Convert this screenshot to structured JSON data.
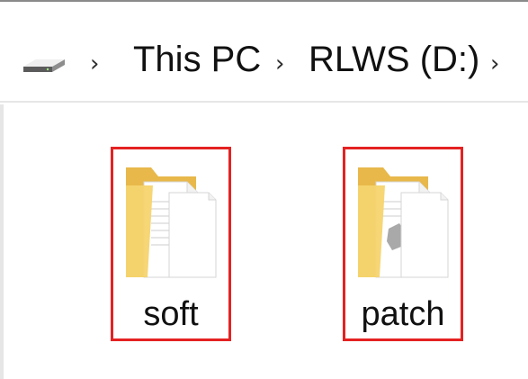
{
  "address_bar": {
    "drive_icon": "drive-icon",
    "crumbs": [
      "This PC",
      "RLWS (D:)"
    ],
    "chevron_icon": "chevron-right-icon",
    "chevron_glyph": "›"
  },
  "folders": [
    {
      "name": "soft",
      "icon": "folder-icon",
      "highlighted": true
    },
    {
      "name": "patch",
      "icon": "folder-icon",
      "highlighted": true
    }
  ],
  "colors": {
    "highlight": "#e52222",
    "folder_yellow": "#f6d46e"
  }
}
